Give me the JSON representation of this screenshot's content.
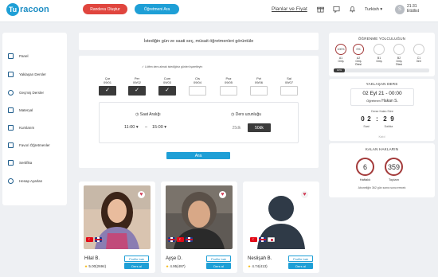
{
  "header": {
    "logo_letter": "Tu",
    "logo_text": "racoon",
    "book_lesson": "Randevu Oluştur",
    "teachers": "Öğretmeni Ara",
    "plans": "Planlar ve Fiyat",
    "language": "Turkish",
    "avatar_letter": "S",
    "time": "21:31",
    "status": "Etütlist"
  },
  "sidebar": {
    "items": [
      {
        "label": "Panel"
      },
      {
        "label": "Yaklaşan Dersler"
      },
      {
        "label": "Geçmiş Dersler"
      },
      {
        "label": "Materyal"
      },
      {
        "label": "Kurslarım"
      },
      {
        "label": "Favori Öğretmenler"
      },
      {
        "label": "Sertifika"
      },
      {
        "label": "Hesap Ayarları"
      }
    ]
  },
  "search": {
    "title": "İstediğin gün ve saati seç, müsait öğretmenleri görüntüle",
    "notice": "✓ Lütfen ders almak istediğiniz günleri işaretleyin",
    "days": [
      {
        "name": "Çar",
        "date": "09/01",
        "checked": true
      },
      {
        "name": "Per",
        "date": "09/02",
        "checked": true
      },
      {
        "name": "Cum",
        "date": "09/03",
        "checked": true
      },
      {
        "name": "Cts",
        "date": "09/04",
        "checked": false
      },
      {
        "name": "Paz",
        "date": "09/05",
        "checked": false
      },
      {
        "name": "Pzt",
        "date": "09/06",
        "checked": false
      },
      {
        "name": "Sal",
        "date": "09/07",
        "checked": false
      }
    ],
    "time_range_label": "Saat Aralığı",
    "time_start": "11:00",
    "time_end": "15:00",
    "duration_label": "Ders uzunluğu",
    "duration_options": [
      "25dk",
      "50dk"
    ],
    "duration_selected": "50dk",
    "search_button": "Ara"
  },
  "teachers": [
    {
      "name": "Hilal B.",
      "rating": "5.00(2694)",
      "profile_btn": "Profile bak",
      "lesson_btn": "Ders al",
      "photo": "woman-dark-hair-icon"
    },
    {
      "name": "Ayşe D.",
      "rating": "4.95(497)",
      "profile_btn": "Profile bak",
      "lesson_btn": "Ders al",
      "photo": "woman-grey-hair-icon"
    },
    {
      "name": "Neslişah B.",
      "rating": "4.74(413)",
      "profile_btn": "Profile bak",
      "lesson_btn": "Ders al",
      "photo": "default-avatar-icon"
    }
  ],
  "journey": {
    "title": "ÖĞRENME YOLCULUĞUN",
    "levels": [
      {
        "badge": "100%",
        "code": "A1",
        "sub": "Giriş"
      },
      {
        "badge": "0%",
        "code": "A2",
        "sub": "Giriş Ötesi"
      },
      {
        "badge": "",
        "code": "B1",
        "sub": "Giriş"
      },
      {
        "badge": "",
        "code": "B2",
        "sub": "Giriş Ötesi"
      },
      {
        "badge": "",
        "code": "C1",
        "sub": "İleri"
      }
    ],
    "progress_label": "10%",
    "progress_value": 0.1
  },
  "upcoming": {
    "title": "YAKLAŞAN DERS",
    "date": "02 Eyl 21 - 00:00",
    "teacher_label": "Öğretmen",
    "teacher": "Hakan S.",
    "remaining_label": "Derse Kalan Süre",
    "hours": "02",
    "minutes": "29",
    "hours_label": "Saat",
    "minutes_label": "Dakika",
    "link": "Katıl"
  },
  "rights": {
    "title": "KALAN HAKLARIN",
    "weekly": "6",
    "weekly_label": "Haftalık",
    "total": "359",
    "total_label": "Toplam",
    "footnote": "Aboneliğin 362 gün sonra sona erecek"
  }
}
